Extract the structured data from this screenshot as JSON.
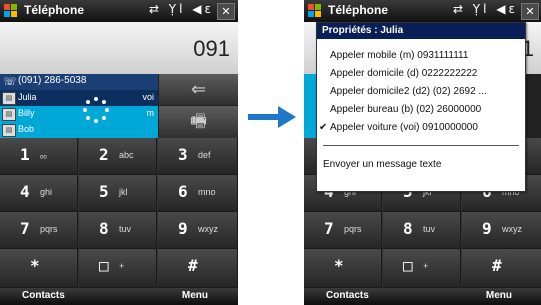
{
  "app": {
    "title": "Téléphone"
  },
  "status": {
    "icons": "⇄ Ỵl ◀ε",
    "close": "✕"
  },
  "dialer": {
    "number": "091",
    "dial_line": "(091) 286-5038",
    "contacts": [
      {
        "name": "Julia",
        "tag": "voi"
      },
      {
        "name": "Billy",
        "tag": "m"
      },
      {
        "name": "Bob",
        "tag": ""
      }
    ],
    "backspace": "⇐",
    "speaker": "🖷"
  },
  "keypad": [
    {
      "digit": "1",
      "letters": "ₒₒ"
    },
    {
      "digit": "2",
      "letters": "abc"
    },
    {
      "digit": "3",
      "letters": "def"
    },
    {
      "digit": "4",
      "letters": "ghi"
    },
    {
      "digit": "5",
      "letters": "jkl"
    },
    {
      "digit": "6",
      "letters": "mno"
    },
    {
      "digit": "7",
      "letters": "pqrs"
    },
    {
      "digit": "8",
      "letters": "tuv"
    },
    {
      "digit": "9",
      "letters": "wxyz"
    },
    {
      "digit": "*",
      "letters": ""
    },
    {
      "digit": "0",
      "letters": "+"
    },
    {
      "digit": "#",
      "letters": ""
    }
  ],
  "softkeys": {
    "left": "Contacts",
    "right": "Menu"
  },
  "menu": {
    "header": "Propriétés : Julia",
    "items": [
      "Appeler mobile (m) 0931111111",
      "Appeler domicile (d) 0222222222",
      "Appeler domicile2 (d2) (02) 2692 ...",
      "Appeler bureau (b) (02) 26000000",
      "Appeler voiture (voi) 0910000000"
    ],
    "checked_item": 4,
    "check_mark": "✔",
    "sms": "Envoyer un message texte"
  },
  "colors": {
    "accent": "#00a8d8",
    "selection": "#0d2f60",
    "arrow": "#1f77c8"
  }
}
